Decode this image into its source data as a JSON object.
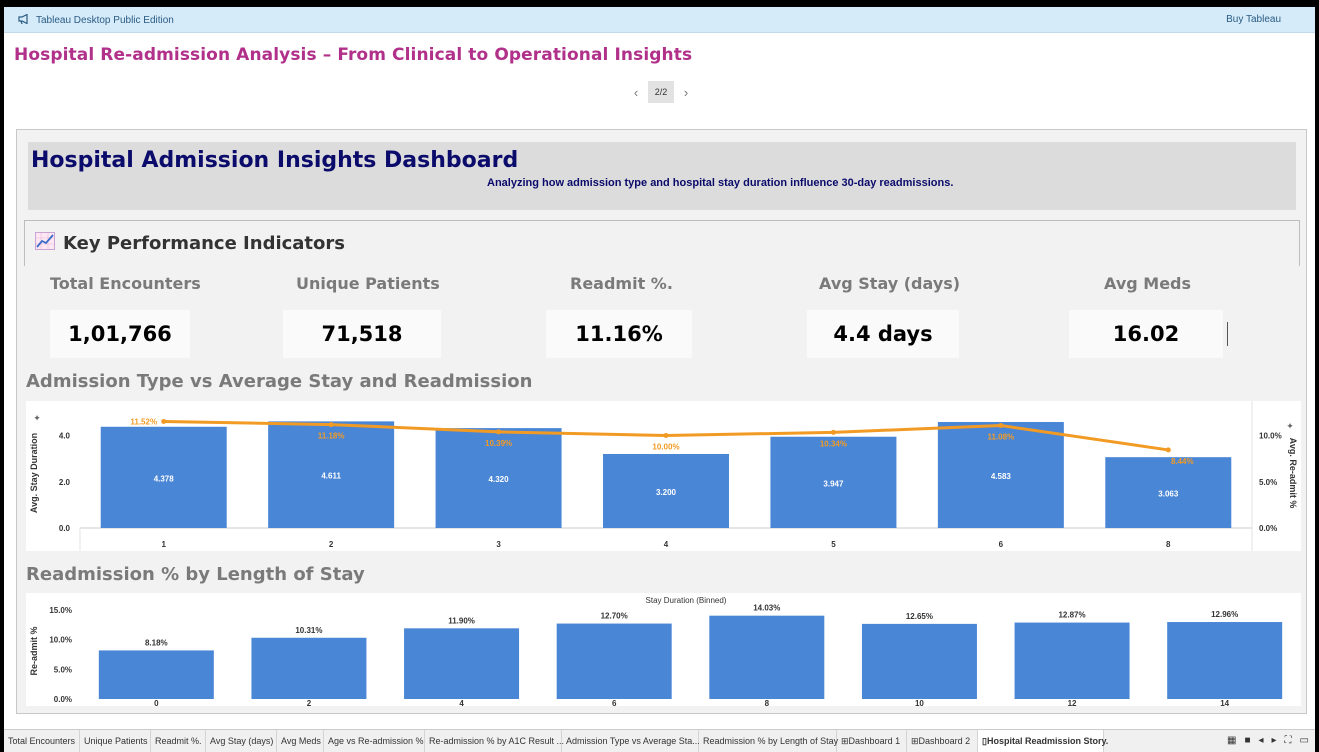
{
  "app": {
    "title": "Tableau Desktop Public Edition",
    "buy_label": "Buy Tableau"
  },
  "story": {
    "title": "Hospital Re-admission Analysis – From Clinical to Operational Insights",
    "page": "2/2",
    "prev_icon": "chevron-left-icon",
    "next_icon": "chevron-right-icon"
  },
  "header": {
    "title": "Hospital Admission Insights Dashboard",
    "subtitle": "Analyzing how admission type and hospital stay duration influence 30-day readmissions."
  },
  "kpi": {
    "section_title": "Key Performance Indicators",
    "items": [
      {
        "label": "Total Encounters",
        "value": "1,01,766"
      },
      {
        "label": "Unique Patients",
        "value": "71,518"
      },
      {
        "label": "Readmit %.",
        "value": "11.16%"
      },
      {
        "label": "Avg Stay (days)",
        "value": "4.4 days"
      },
      {
        "label": "Avg Meds",
        "value": "16.02"
      }
    ]
  },
  "colors": {
    "bar": "#4a86d6",
    "line": "#f29b24",
    "title": "#b1308a",
    "header": "#0b0b6b"
  },
  "chart_data": [
    {
      "type": "bar",
      "title": "Admission Type vs Average Stay and Readmission",
      "categories": [
        "1",
        "2",
        "3",
        "4",
        "5",
        "6",
        "8"
      ],
      "ylabel": "Avg. Stay Duration",
      "y2label": "Avg. Re-admit %",
      "ylim": [
        0,
        4.8
      ],
      "y2lim": [
        0,
        12
      ],
      "yticks": [
        "0.0",
        "2.0",
        "4.0"
      ],
      "y2ticks": [
        "0.0%",
        "5.0%",
        "10.0%"
      ],
      "series": [
        {
          "type": "bar",
          "values": [
            4.378,
            4.611,
            4.32,
            3.2,
            3.947,
            4.583,
            3.063
          ],
          "labels": [
            "4.378",
            "4.611",
            "4.320",
            "3.200",
            "3.947",
            "4.583",
            "3.063"
          ]
        },
        {
          "type": "line",
          "axis": "right",
          "values": [
            11.52,
            11.18,
            10.39,
            10.0,
            10.34,
            11.08,
            8.44
          ],
          "labels": [
            "11.52%",
            "11.18%",
            "10.39%",
            "10.00%",
            "10.34%",
            "11.08%",
            "8.44%"
          ]
        }
      ],
      "grid": false
    },
    {
      "type": "bar",
      "title": "Readmission % by Length of Stay",
      "xlabel": "Stay Duration (Binned)",
      "ylabel": "Re-admit %",
      "categories": [
        "0",
        "2",
        "4",
        "6",
        "8",
        "10",
        "12",
        "14"
      ],
      "ylim": [
        0,
        16.5
      ],
      "yticks": [
        "0.0%",
        "5.0%",
        "10.0%",
        "15.0%"
      ],
      "values": [
        8.18,
        10.31,
        11.9,
        12.7,
        14.03,
        12.65,
        12.87,
        12.96
      ],
      "labels": [
        "8.18%",
        "10.31%",
        "11.90%",
        "12.70%",
        "14.03%",
        "12.65%",
        "12.87%",
        "12.96%"
      ],
      "grid": false
    }
  ],
  "tabs": [
    "Total Encounters",
    "Unique Patients",
    "Readmit %.",
    "Avg Stay (days)",
    "Avg Meds",
    "Age vs Re-admission %",
    "Re-admission % by A1C Result ...",
    "Admission Type vs Average Sta...",
    "Readmission % by Length of Stay",
    "Dashboard 1",
    "Dashboard 2",
    "Hospital Readmission Story."
  ]
}
